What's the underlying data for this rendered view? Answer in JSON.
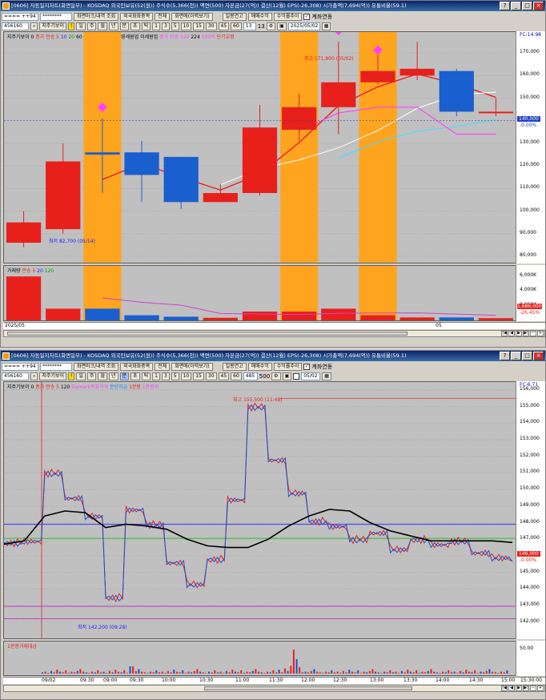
{
  "window1": {
    "title": "[0606] 자동일지차트(화면일부) - KOSDAQ 외국인보유(52(원)) 주식수(5,366(천)) 액면(500) 자본금(27(억)) 결산(12월) EPS(-26,308) 시가총액(7,694(억)) 유통비율(59.1)",
    "code_value": "==== ++94",
    "pwd_value": "********",
    "buttons": [
      "화면마크/내역 조회",
      "외국화화중목",
      "전체",
      "화면에(이력보기)",
      "일봉연고",
      "매매수익",
      "수익률추이"
    ],
    "checkbox_label": "계좌연동",
    "row2": {
      "code": "456160",
      "label": "지주기보이",
      "periods": [
        "일",
        "주",
        "월",
        "년",
        "분",
        "초",
        "틱"
      ],
      "intervals": [
        "1",
        "3",
        "5",
        "10",
        "15",
        "30",
        "45",
        "60"
      ],
      "count_value": "13",
      "count_total": "13",
      "date_value": "2025/05/02"
    },
    "legend_main": [
      "지주기보이 0",
      "종가 만승 5",
      "10",
      "20",
      "60",
      "500억원다른세전 영세원업",
      "이세원업",
      "종가 만승 120",
      "224",
      "100억",
      "단기교점"
    ],
    "legend_vol": [
      "거래량",
      "만승 5",
      "20",
      "120"
    ],
    "yaxis_prices": [
      "170,000",
      "160,000",
      "150,000",
      "140,000",
      "130,000",
      "120,000",
      "110,000",
      "100,000",
      "90,000",
      "80,000"
    ],
    "yaxis_top": "FC-14.98",
    "last_price": "140,000",
    "last_pct": "-0.00%",
    "yaxis_volume": [
      "6,000K",
      "4,000K",
      "2,000K"
    ],
    "vol_last": "1,686,000",
    "vol_pct": "-26.45%",
    "annot_high": "최고 171,800 (05/02)",
    "annot_low": "최저 82,700 (05/14)",
    "x_labels": [
      "2025/05",
      "05"
    ],
    "colors": {
      "up": "#e8201c",
      "down": "#1a5fcf",
      "highlight": "#ffa41e",
      "background": "#c0c0c0",
      "marker": "#ff40ff"
    }
  },
  "window2": {
    "title": "[0606] 자동일지차트(화면일부) - KOSDAQ 외국인보유(52(원)) 주식수(5,366(천)) 액면(500) 자본금(27(억)) 결산(12월) EPS(-26,308) 시가총액(7,694(억)) 유통비율(59.1)",
    "code_value": "==== ++94",
    "pwd_value": "********",
    "buttons": [
      "화면마크/내역 조회",
      "외국화화중목",
      "전체",
      "화면에(이력보기)",
      "일봉연고",
      "매매수익",
      "수익률추이"
    ],
    "checkbox_label": "계좌연동",
    "row2": {
      "code": "456160",
      "label": "지주기보이",
      "periods": [
        "일",
        "주",
        "월",
        "년",
        "분",
        "초",
        "틱"
      ],
      "intervals": [
        "1",
        "3",
        "5",
        "10",
        "15",
        "30",
        "45",
        "60"
      ],
      "count_value": "485",
      "count_total": "500",
      "date_value": "05/02"
    },
    "legend_main": [
      "지주기보이 0",
      "종가 만승 5",
      "120",
      "Demark목표가격",
      "분단지금",
      "1분봉",
      "1분봉의"
    ],
    "legend_vol": [
      "1분봉거래대금"
    ],
    "yaxis_prices": [
      "156,000",
      "155,000",
      "154,000",
      "153,000",
      "152,000",
      "151,000",
      "150,000",
      "149,000",
      "148,000",
      "147,000",
      "146,000",
      "145,000",
      "144,000",
      "143,000",
      "142,000"
    ],
    "yaxis_top": "FC-6.71",
    "last_price": "146,000",
    "last_pct": "-0.00%",
    "yaxis_volume": [
      "50.00"
    ],
    "annot_high": "최고 155,500 (11:48)",
    "annot_low": "최저 142,200 (09:28)",
    "x_labels": [
      "09/02",
      "09:30",
      "09:00",
      "09:30",
      "10:00",
      "10:30",
      "11:00",
      "11:30",
      "12:00",
      "12:30",
      "13:00",
      "13:30",
      "14:00",
      "14:30",
      "15:00",
      "15:30:00"
    ],
    "x_right": "09/02"
  },
  "chart_data": [
    {
      "type": "candlestick",
      "title": "",
      "x": [
        "c1",
        "c2",
        "c3",
        "c4",
        "c5",
        "c6",
        "c7",
        "c8",
        "c9",
        "c10",
        "c11",
        "c12",
        "c13"
      ],
      "open": [
        86000,
        92000,
        126000,
        126000,
        124000,
        104000,
        108000,
        136000,
        146000,
        157000,
        160000,
        162000,
        144000
      ],
      "close": [
        95000,
        122000,
        125000,
        116000,
        104000,
        108000,
        137000,
        146000,
        157000,
        162000,
        163000,
        144000,
        144000
      ],
      "high": [
        100000,
        130000,
        141000,
        131000,
        124000,
        112000,
        147000,
        152000,
        175000,
        172000,
        175000,
        163000,
        150000
      ],
      "low": [
        84000,
        90000,
        108000,
        104000,
        101000,
        104000,
        107000,
        131000,
        134000,
        156000,
        158000,
        142000,
        142000
      ],
      "volume_k": [
        6000,
        1600,
        1600,
        700,
        500,
        350,
        1200,
        1200,
        1600,
        700,
        400,
        400,
        300
      ],
      "highlighted_candles": [
        2,
        7,
        9
      ],
      "marker_candles": [
        2,
        8,
        9
      ],
      "ylim": [
        80000,
        175000
      ]
    },
    {
      "type": "line",
      "title": "",
      "x_label_times": [
        "09:00",
        "09:30",
        "10:00",
        "10:30",
        "11:00",
        "11:30",
        "12:00",
        "12:30",
        "13:00",
        "13:30",
        "14:00",
        "14:30",
        "15:00"
      ],
      "series": [
        {
          "values": [
            146800,
            146900,
            151000,
            149500,
            148400,
            143500,
            148800,
            147900,
            145600,
            144300,
            145800,
            149400,
            155000,
            151800,
            149800,
            148100,
            147800,
            147000,
            147400,
            146400,
            147000,
            146700,
            146900,
            146200,
            145900,
            145700
          ]
        },
        {
          "values": [
            146700,
            146900,
            148400,
            148700,
            148600,
            147700,
            147900,
            147800,
            147600,
            147000,
            146600,
            146500,
            146500,
            147000,
            147800,
            148400,
            148800,
            148700,
            148000,
            147500,
            147200,
            146900,
            146900,
            146900,
            146900,
            146800
          ]
        }
      ],
      "hlines": [
        147900,
        147050,
        142950,
        142200
      ],
      "ylim": [
        141500,
        156000
      ]
    }
  ]
}
